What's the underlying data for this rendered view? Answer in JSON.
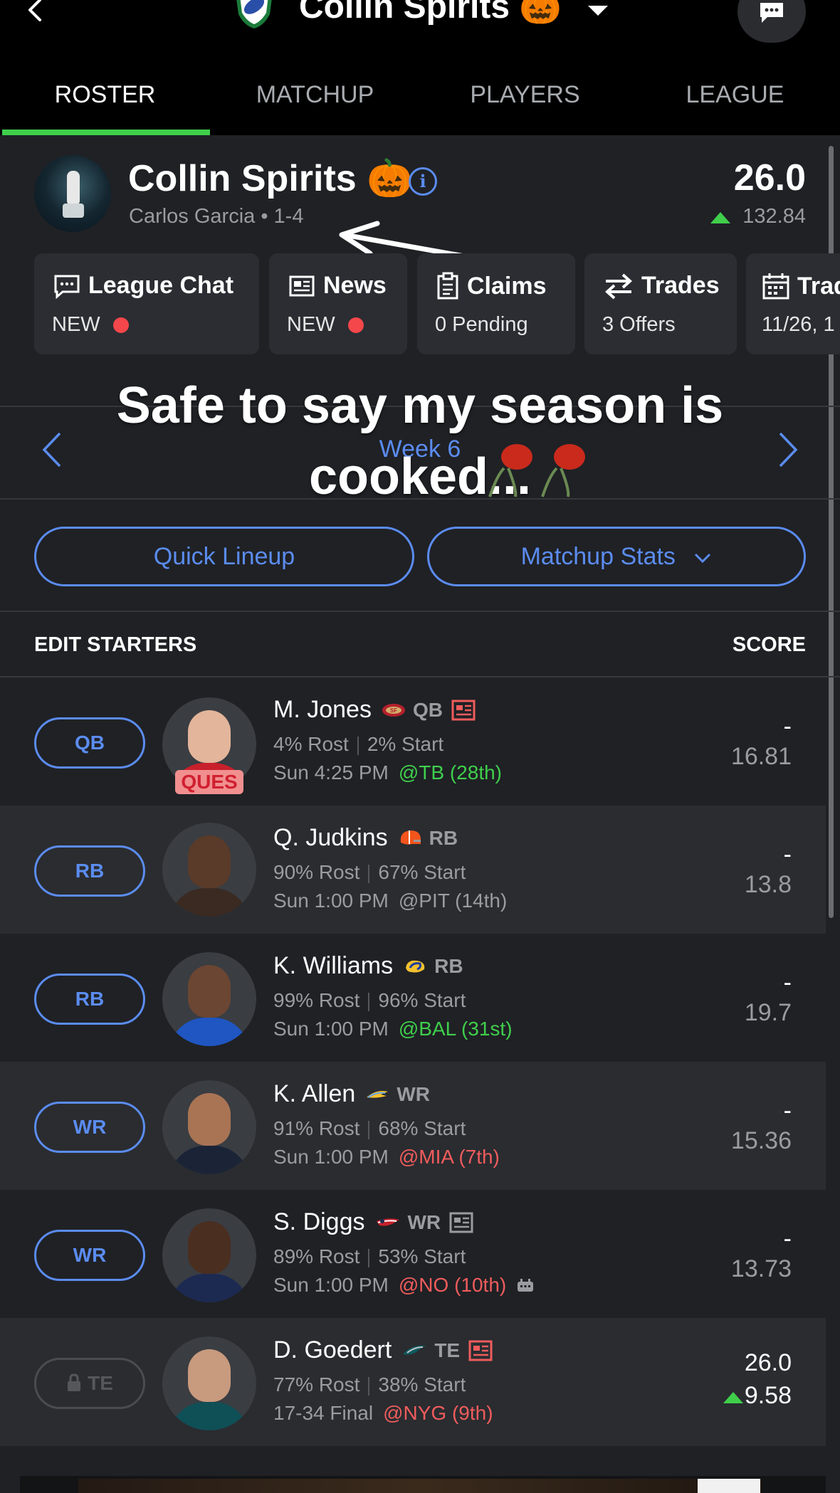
{
  "header": {
    "team_title": "Collin Spirits 🎃",
    "tabs": [
      {
        "label": "ROSTER",
        "active": true
      },
      {
        "label": "MATCHUP",
        "active": false
      },
      {
        "label": "PLAYERS",
        "active": false
      },
      {
        "label": "LEAGUE",
        "active": false
      }
    ]
  },
  "team": {
    "name": "Collin Spirits 🎃",
    "owner_record": "Carlos Garcia • 1-4",
    "score": "26.0",
    "projection": "132.84"
  },
  "cards": [
    {
      "icon": "chat-icon",
      "title": "League Chat",
      "sub": "NEW",
      "dot": true
    },
    {
      "icon": "news-icon",
      "title": "News",
      "sub": "NEW",
      "dot": true
    },
    {
      "icon": "clipboard-icon",
      "title": "Claims",
      "sub": "0 Pending",
      "dot": false
    },
    {
      "icon": "trade-arrows-icon",
      "title": "Trades",
      "sub": "3 Offers",
      "dot": false
    },
    {
      "icon": "calendar-icon",
      "title": "Trad",
      "sub": "11/26, 1",
      "dot": false
    }
  ],
  "week": {
    "label": "Week 6"
  },
  "caption": "Safe to say my season is cooked...",
  "buttons": {
    "quick_lineup": "Quick Lineup",
    "matchup_stats": "Matchup Stats"
  },
  "list_header": {
    "edit": "EDIT STARTERS",
    "score": "SCORE"
  },
  "players": [
    {
      "slot": "QB",
      "name": "M. Jones",
      "team_logo": "49ers-logo-icon",
      "pos": "QB",
      "news": true,
      "rost": "4% Rost",
      "start": "2% Start",
      "time": "Sun 4:25 PM",
      "opp": "@TB (28th)",
      "opp_color": "#3fcf4b",
      "score": "-",
      "proj": "16.81",
      "status": "QUES",
      "locked": false
    },
    {
      "slot": "RB",
      "name": "Q. Judkins",
      "team_logo": "browns-helmet-icon",
      "pos": "RB",
      "news": false,
      "rost": "90% Rost",
      "start": "67% Start",
      "time": "Sun 1:00 PM",
      "opp": "@PIT (14th)",
      "opp_color": "#9a9ca1",
      "score": "-",
      "proj": "13.8",
      "status": "",
      "locked": false
    },
    {
      "slot": "RB",
      "name": "K. Williams",
      "team_logo": "rams-logo-icon",
      "pos": "RB",
      "news": false,
      "rost": "99% Rost",
      "start": "96% Start",
      "time": "Sun 1:00 PM",
      "opp": "@BAL (31st)",
      "opp_color": "#3fcf4b",
      "score": "-",
      "proj": "19.7",
      "status": "",
      "locked": false
    },
    {
      "slot": "WR",
      "name": "K. Allen",
      "team_logo": "chargers-bolt-icon",
      "pos": "WR",
      "news": false,
      "rost": "91% Rost",
      "start": "68% Start",
      "time": "Sun 1:00 PM",
      "opp": "@MIA (7th)",
      "opp_color": "#f05c5c",
      "score": "-",
      "proj": "15.36",
      "status": "",
      "locked": false
    },
    {
      "slot": "WR",
      "name": "S. Diggs",
      "team_logo": "patriots-logo-icon",
      "pos": "WR",
      "news": true,
      "rost": "89% Rost",
      "start": "53% Start",
      "time": "Sun 1:00 PM",
      "opp": "@NO (10th)",
      "opp_color": "#f05c5c",
      "score": "-",
      "proj": "13.73",
      "status": "",
      "locked": false
    },
    {
      "slot": "TE",
      "name": "D. Goedert",
      "team_logo": "eagles-logo-icon",
      "pos": "TE",
      "news": true,
      "rost": "77% Rost",
      "start": "38% Start",
      "time": "17-34 Final",
      "opp": "@NYG (9th)",
      "opp_color": "#f05c5c",
      "score": "26.0",
      "proj": "9.58",
      "status": "",
      "locked": true
    }
  ],
  "colors": {
    "accent": "#5b8cf0",
    "active_tab": "#3fcf4b",
    "positive": "#3fcf4b",
    "negative": "#f05c5c",
    "alert": "#f4474b"
  }
}
